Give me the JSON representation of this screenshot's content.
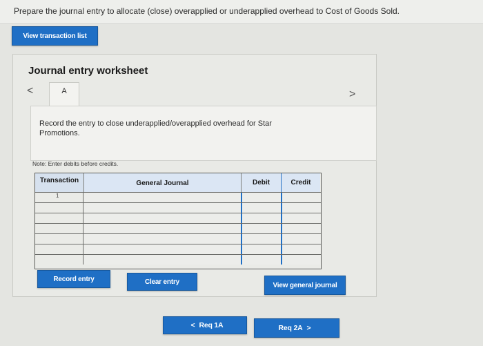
{
  "question": {
    "text": "Prepare the journal entry to allocate (close) overapplied or underapplied overhead to Cost of Goods Sold."
  },
  "buttons": {
    "view_transaction_list": "View transaction list",
    "record_entry": "Record entry",
    "clear_entry": "Clear entry",
    "view_general_journal": "View general journal",
    "prev_label": "Req 1A",
    "next_label": "Req 2A",
    "prev_chevron": "<",
    "next_chevron": ">"
  },
  "worksheet": {
    "title": "Journal entry worksheet",
    "nav_left": "<",
    "nav_right": ">",
    "tab": "A",
    "instruction": "Record the entry to close underapplied/overapplied overhead for Star Promotions.",
    "note": "Note: Enter debits before credits."
  },
  "table": {
    "headers": {
      "transaction": "Transaction",
      "general_journal": "General Journal",
      "debit": "Debit",
      "credit": "Credit"
    },
    "rows": [
      {
        "transaction": "1",
        "account": "",
        "debit": "",
        "credit": ""
      },
      {
        "transaction": "",
        "account": "",
        "debit": "",
        "credit": ""
      },
      {
        "transaction": "",
        "account": "",
        "debit": "",
        "credit": ""
      },
      {
        "transaction": "",
        "account": "",
        "debit": "",
        "credit": ""
      },
      {
        "transaction": "",
        "account": "",
        "debit": "",
        "credit": ""
      },
      {
        "transaction": "",
        "account": "",
        "debit": "",
        "credit": ""
      },
      {
        "transaction": "",
        "account": "",
        "debit": "",
        "credit": ""
      }
    ]
  },
  "colors": {
    "accent": "#1f6fc5",
    "header_fill": "#dbe6f4"
  }
}
